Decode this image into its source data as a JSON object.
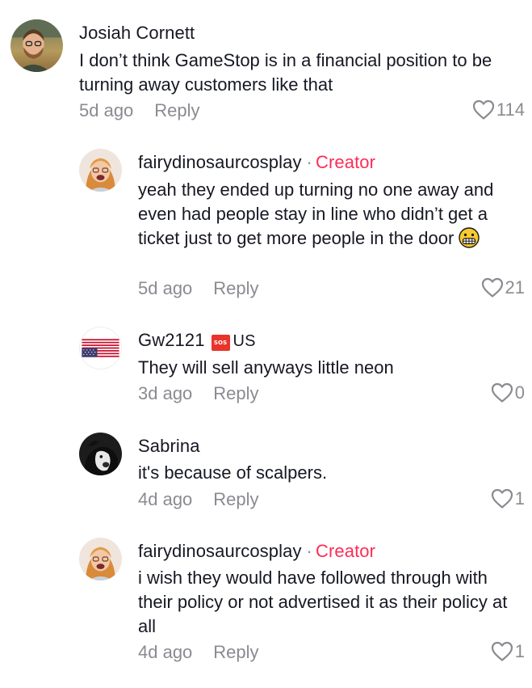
{
  "comments": [
    {
      "author": "Josiah Cornett",
      "text": "I don’t think GameStop is in a financial position to be turning away customers like that",
      "time": "5d ago",
      "reply_label": "Reply",
      "likes": "114"
    },
    {
      "author": "fairydinosaurcosplay",
      "separator": "·",
      "creator_label": "Creator",
      "text": "yeah they ended up turning no one away and even had people stay in line who didn’t get a ticket just to get more people in the door",
      "emoji": "grimacing-face",
      "time": "5d ago",
      "reply_label": "Reply",
      "likes": "21"
    },
    {
      "author": "Gw2121",
      "badge_text": "SOS",
      "region_text": "US",
      "text": "They will sell anyways little neon",
      "time": "3d ago",
      "reply_label": "Reply",
      "likes": "0"
    },
    {
      "author": "Sabrina",
      "text": "it's because of scalpers.",
      "time": "4d ago",
      "reply_label": "Reply",
      "likes": "1"
    },
    {
      "author": "fairydinosaurcosplay",
      "separator": "·",
      "creator_label": "Creator",
      "text": "i wish they would have followed through with their policy or not advertised it as their policy at all",
      "time": "4d ago",
      "reply_label": "Reply",
      "likes": "1"
    }
  ],
  "colors": {
    "text": "#161823",
    "secondary": "#8a8b91",
    "creator": "#fe2c55",
    "badge": "#e8342b"
  },
  "icons": {
    "like": "heart-outline-icon",
    "emoji": "grimacing-face-emoji"
  }
}
